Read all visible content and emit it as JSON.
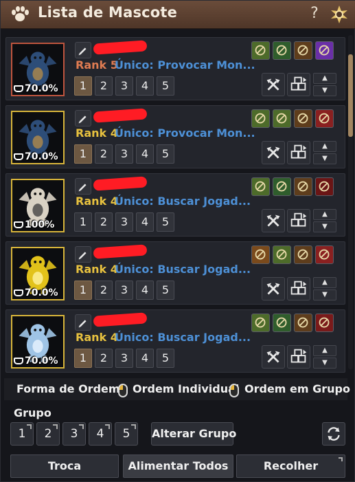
{
  "window": {
    "title": "Lista de Mascote",
    "help_label": "?"
  },
  "pets": [
    {
      "rank": "Rank 5",
      "unique": "Único: Provocar Mon...",
      "food": "70.0%",
      "border": "red",
      "skills": [
        "#4d6b2a",
        "#2f5d2c",
        "#5e3d1c",
        "#6a2fa8"
      ],
      "skill_icons": [
        "horse-icon",
        "horseshoe-icon",
        "axe-icon",
        "buff-purple-icon"
      ],
      "active_order": "1",
      "portrait": {
        "body": "#2d4d78",
        "accent": "#b08a4a"
      }
    },
    {
      "rank": "Rank 4",
      "unique": "Único: Provocar Mon...",
      "food": "70.0%",
      "border": "gold",
      "skills": [
        "#4d6b2a",
        "#4d6b2a",
        "#5e3d1c",
        "#8a2020"
      ],
      "skill_icons": [
        "roast-icon",
        "horse-icon",
        "axe-icon",
        "buff-red-icon"
      ],
      "active_order": "1",
      "portrait": {
        "body": "#2d4d78",
        "accent": "#b08a4a"
      }
    },
    {
      "rank": "Rank 4",
      "unique": "Único: Buscar Jogad...",
      "food": "100%",
      "border": "gold",
      "skills": [
        "#4d6b2a",
        "#2f5d2c",
        "#5e3d1c",
        "#6a1515"
      ],
      "skill_icons": [
        "horse-icon",
        "horseshoe-icon",
        "axe-icon",
        "buff-dark-red-icon"
      ],
      "active_order": null,
      "portrait": {
        "body": "#d9d2c4",
        "accent": "#444444"
      }
    },
    {
      "rank": "Rank 4",
      "unique": "Único: Buscar Jogad...",
      "food": "70.0%",
      "border": "gold",
      "skills": [
        "#7a4a1c",
        "#4d6b2a",
        "#5e3d1c",
        "#8a2020"
      ],
      "skill_icons": [
        "hammer-icon",
        "horse-icon",
        "axe-icon",
        "buff-red-icon"
      ],
      "active_order": "1",
      "portrait": {
        "body": "#e2c21a",
        "accent": "#fff2a0"
      }
    },
    {
      "rank": "Rank 4",
      "unique": "Único: Buscar Jogad...",
      "food": "70.0%",
      "border": "gold",
      "skills": [
        "#4d6b2a",
        "#2f5d2c",
        "#5e3d1c",
        "#7a1a1a"
      ],
      "skill_icons": [
        "roast-icon",
        "pickaxe-icon",
        "axe-icon",
        "target-red-icon"
      ],
      "active_order": "1",
      "portrait": {
        "body": "#9fc4e6",
        "accent": "#e8f4ff"
      }
    }
  ],
  "order_numbers": [
    "1",
    "2",
    "3",
    "4",
    "5"
  ],
  "sort": {
    "label": "Forma de Ordem",
    "individual": "Ordem Individual",
    "group": "Ordem em Grupo"
  },
  "group": {
    "label": "Grupo",
    "buttons": [
      "1",
      "2",
      "3",
      "4",
      "5"
    ],
    "alter": "Alterar Grupo"
  },
  "bottom": {
    "trade": "Troca",
    "feed_all": "Alimentar Todos",
    "collect": "Recolher"
  },
  "colors": {
    "accent": "#e8c23f",
    "rank5": "#e07c52",
    "unique": "#4d90d6",
    "titlebar": "#5e4030"
  }
}
